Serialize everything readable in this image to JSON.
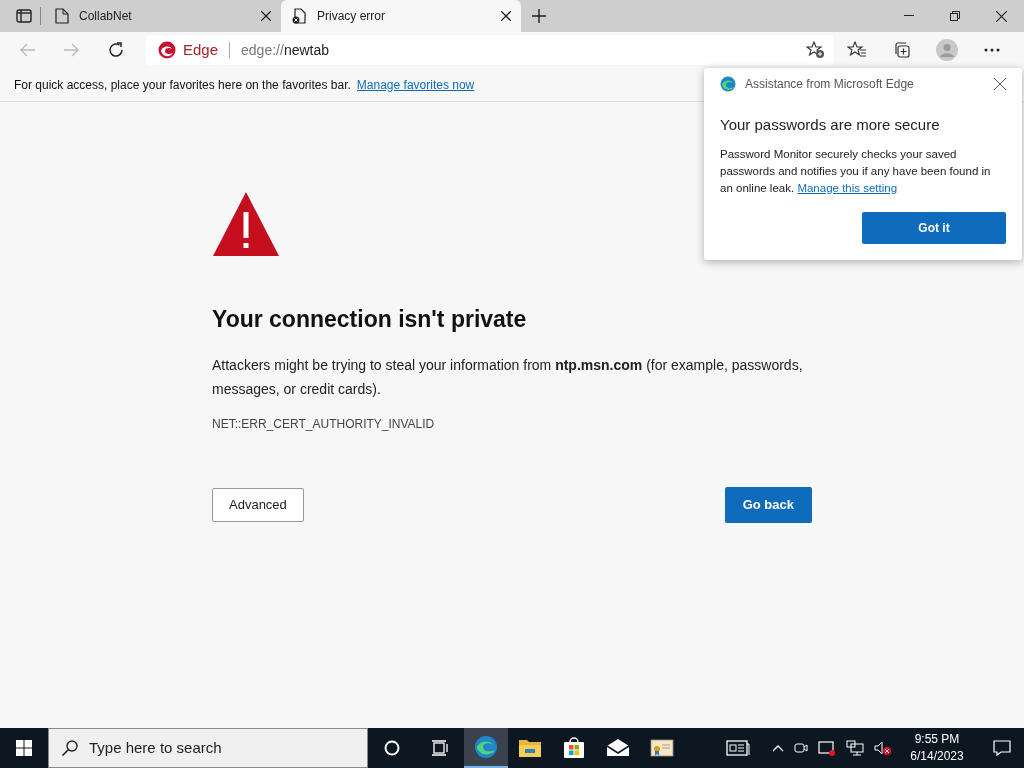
{
  "tabs": [
    {
      "title": "CollabNet",
      "selected": false,
      "kind": "page"
    },
    {
      "title": "Privacy error",
      "selected": true,
      "kind": "error"
    }
  ],
  "address_bar": {
    "brand": "Edge",
    "url_prefix": "edge://",
    "url_main": "newtab"
  },
  "favorites_bar": {
    "message": "For quick access, place your favorites here on the favorites bar.",
    "link": "Manage favorites now"
  },
  "error_page": {
    "title": "Your connection isn't private",
    "description": "Attackers might be trying to steal your information from **ntp.msn.com** (for example, passwords, messages, or credit cards).",
    "error_code": "NET::ERR_CERT_AUTHORITY_INVALID",
    "buttons": [
      {
        "label": "Advanced",
        "kind": "secondary"
      },
      {
        "label": "Go back",
        "kind": "primary"
      }
    ]
  },
  "popup": {
    "header": "Assistance from Microsoft Edge",
    "title": "Your passwords are more secure",
    "body": "Password Monitor securely checks your saved passwords and notifies you if any have been found in an online leak.",
    "link": "Manage this setting",
    "button": "Got it"
  },
  "taskbar": {
    "search_placeholder": "Type here to search",
    "apps": [
      {
        "kind": "edge",
        "selected": true
      },
      {
        "kind": "folder",
        "selected": false
      },
      {
        "kind": "store",
        "selected": false
      },
      {
        "kind": "mail",
        "selected": false
      },
      {
        "kind": "certificate",
        "selected": false
      }
    ],
    "time": "9:55 PM",
    "date": "6/14/2023"
  }
}
